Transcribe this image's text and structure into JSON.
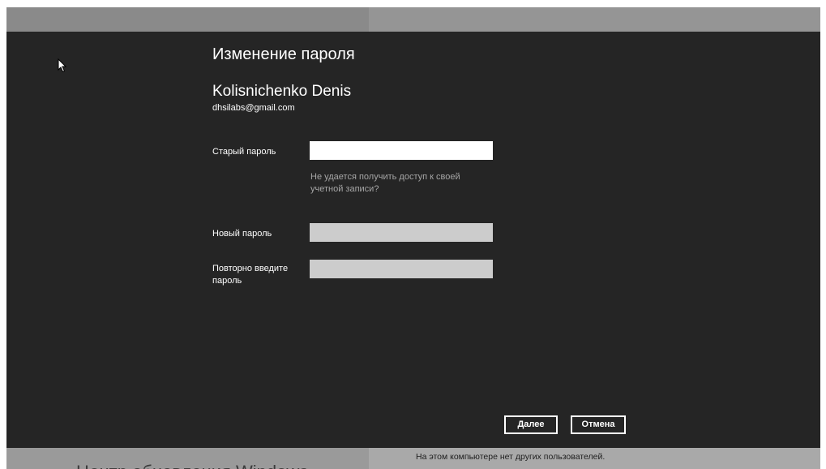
{
  "background": {
    "partial_title": "Центр обновления Windows",
    "status_text": "На этом компьютере нет других пользователей."
  },
  "dialog": {
    "title": "Изменение пароля",
    "user_name": "Kolisnichenko Denis",
    "user_email": "dhsilabs@gmail.com",
    "old_password_label": "Старый пароль",
    "old_password_value": "",
    "help_link": "Не удается получить доступ к своей учетной записи?",
    "new_password_label": "Новый пароль",
    "new_password_value": "",
    "confirm_password_label": "Повторно введите пароль",
    "confirm_password_value": "",
    "next_button": "Далее",
    "cancel_button": "Отмена"
  },
  "colors": {
    "dialog_background": "#252525",
    "text": "#ffffff",
    "link": "#a6a6a6",
    "inactive_input": "#cccccc"
  }
}
